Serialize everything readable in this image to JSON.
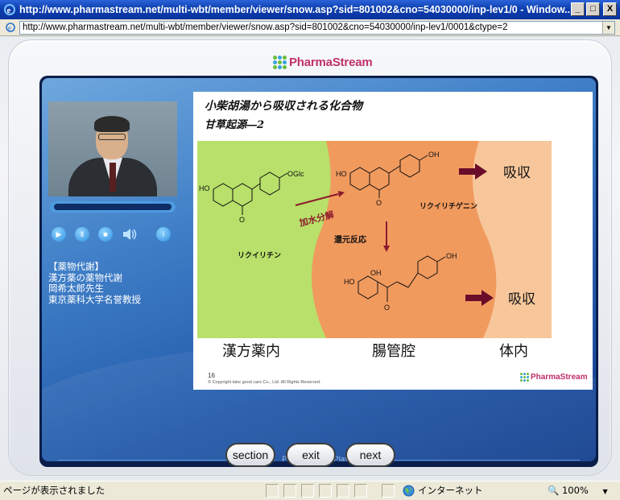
{
  "window": {
    "title": "http://www.pharmastream.net/multi-wbt/member/viewer/snow.asp?sid=801002&cno=54030000/inp-lev1/0 - Window...",
    "minimize_label": "_",
    "maximize_label": "□",
    "close_label": "X"
  },
  "address_bar": {
    "url": "http://www.pharmastream.net/multi-wbt/member/viewer/snow.asp?sid=801002&cno=54030000/inp-lev1/0001&ctype=2"
  },
  "brand": {
    "logo_text": "PharmaStream",
    "player_label": "PharmaStreamPlayer",
    "colors": {
      "logo": "#c0306a",
      "stage": "#2158a8"
    }
  },
  "player": {
    "progress": 1.0,
    "controls": [
      {
        "name": "play-icon",
        "glyph": "▶"
      },
      {
        "name": "pause-icon",
        "glyph": "Ⅱ"
      },
      {
        "name": "stop-icon",
        "glyph": "■"
      },
      {
        "name": "volume-icon",
        "glyph": "🔊"
      },
      {
        "name": "info-icon",
        "glyph": "i"
      }
    ]
  },
  "lecture_info": {
    "line1": "【薬物代謝】",
    "line2": "漢方薬の薬物代謝",
    "line3": "岡希太郎先生",
    "line4": "東京薬科大学名誉教授"
  },
  "slide": {
    "title": "小柴胡湯から吸収される化合物",
    "subtitle": "甘草起源―2",
    "compound1": "リクイリチン",
    "compound2": "リクイリチゲニン",
    "reaction1": "加水分解",
    "reaction2": "還元反応",
    "absorb1": "吸収",
    "absorb2": "吸収",
    "chem_oglc": "OGlc",
    "chem_ho": "HO",
    "chem_oh": "OH",
    "chem_o": "O",
    "region1": "漢方薬内",
    "region2": "腸管腔",
    "region3": "体内",
    "page_number": "16",
    "copyright": "© Copyright take good care Co., Ltd. All Rights Reserved."
  },
  "nav": {
    "section": "section",
    "exit": "exit",
    "next": "next"
  },
  "statusbar": {
    "message": "ページが表示されました",
    "zone": "インターネット",
    "zoom": "100%"
  }
}
